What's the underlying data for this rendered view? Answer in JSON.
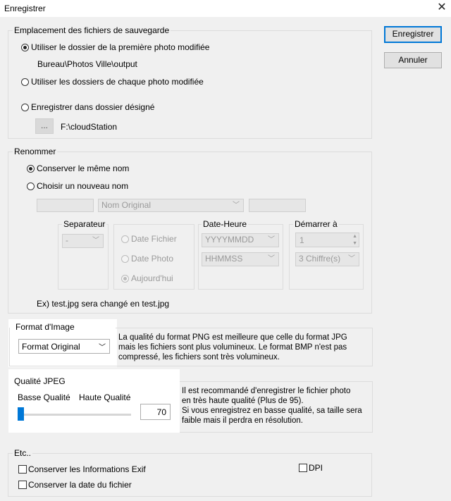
{
  "window": {
    "title": "Enregistrer",
    "close_glyph": "✕"
  },
  "buttons": {
    "save": "Enregistrer",
    "cancel": "Annuler"
  },
  "location": {
    "legend": "Emplacement des fichiers de sauvegarde",
    "opt_first": "Utiliser le dossier de la première photo modifiée",
    "first_path": "Bureau\\Photos Ville\\output",
    "opt_each": "Utiliser les dossiers de chaque photo modifiée",
    "opt_designated": "Enregistrer dans dossier désigné",
    "browse": "...",
    "designated_path": "F:\\cloudStation"
  },
  "rename": {
    "legend": "Renommer",
    "opt_keep": "Conserver le même nom",
    "opt_new": "Choisir un nouveau nom",
    "name_select": "Nom Original",
    "separator_label": "Separateur",
    "separator_value": "-",
    "date_file": "Date Fichier",
    "date_photo": "Date Photo",
    "today": "Aujourd'hui",
    "datetime_label": "Date-Heure",
    "date_format": "YYYYMMDD",
    "time_format": "HHMMSS",
    "start_label": "Démarrer à",
    "start_value": "1",
    "digits": "3 Chiffre(s)",
    "example": "Ex) test.jpg sera changé en test.jpg"
  },
  "format": {
    "legend": "Format d'Image",
    "value": "Format Original",
    "info": "La qualité du format PNG est meilleure que celle du format JPG mais les fichiers sont plus volumineux. Le format BMP n'est pas compressé, les fichiers sont très volumineux."
  },
  "quality": {
    "legend": "Qualité JPEG",
    "low": "Basse Qualité",
    "high": "Haute Qualité",
    "value": "70",
    "slider_fraction": 0.0,
    "info_line1": "Il est recommandé d'enregistrer le fichier photo",
    "info_line2": "en très haute qualité (Plus de 95).",
    "info_line3": "Si vous enregistrez en basse qualité, sa taille sera",
    "info_line4": "faible mais il perdra en résolution."
  },
  "etc": {
    "legend": "Etc..",
    "exif": "Conserver les Informations Exif",
    "date": "Conserver la date du fichier",
    "dpi": "DPI"
  }
}
